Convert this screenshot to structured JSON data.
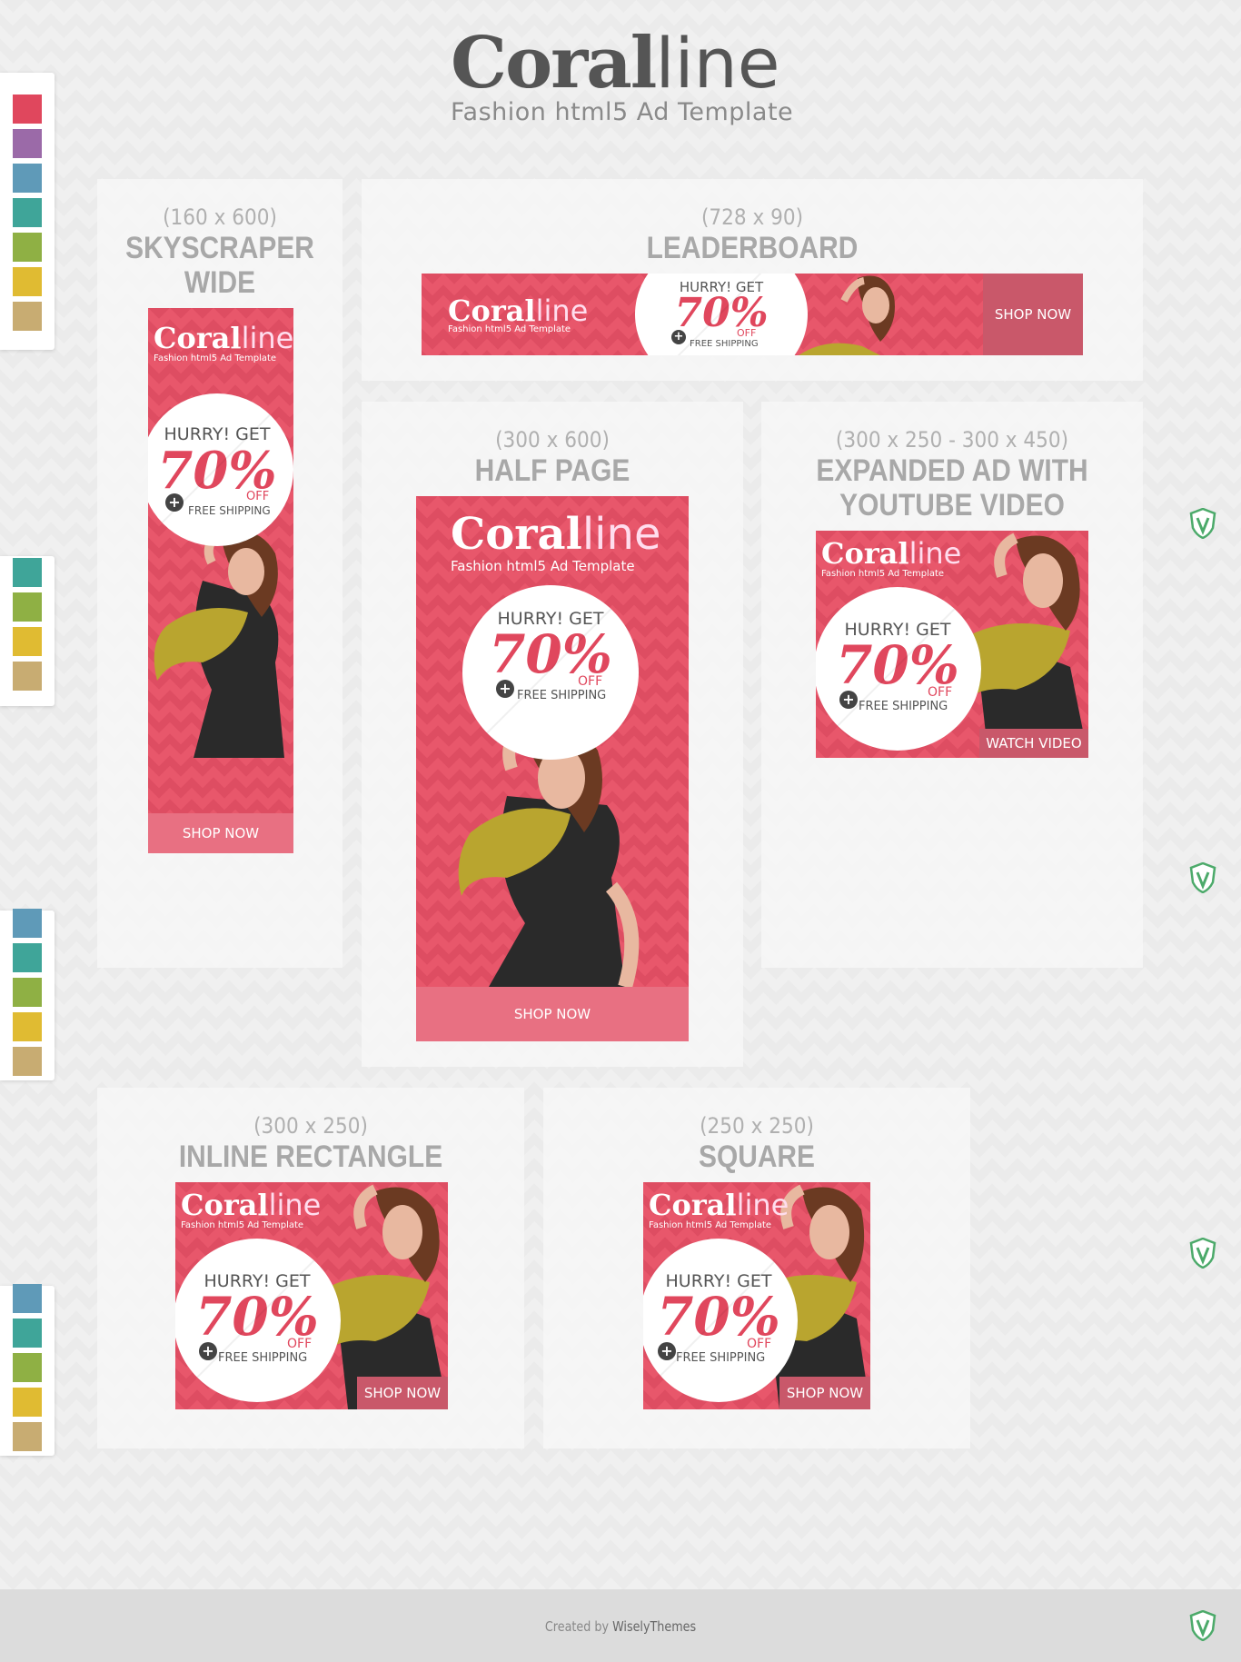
{
  "header": {
    "brand_bold": "Coral",
    "brand_light": "ine",
    "brand_l": "l",
    "tagline": "Fashion html5 Ad Template"
  },
  "ad_copy": {
    "brand_bold": "Coral",
    "brand_light": "line",
    "tagline": "Fashion html5 Ad Template",
    "hurry": "HURRY!",
    "get": "GET",
    "percent": "70%",
    "off": "OFF",
    "free_shipping": "FREE SHIPPING",
    "plus": "+",
    "shop_now": "SHOP NOW",
    "watch_video": "WATCH VIDEO"
  },
  "panels": {
    "skyscraper": {
      "size": "(160 x 600)",
      "name_1": "SKYSCRAPER",
      "name_2": "WIDE"
    },
    "leaderboard": {
      "size": "(728 x 90)",
      "name_1": "LEADERBOARD"
    },
    "half_page": {
      "size": "(300 x 600)",
      "name_1": "HALF PAGE"
    },
    "expanded": {
      "size": "(300 x 250 - 300 x 450)",
      "name_1": "EXPANDED AD WITH",
      "name_2": "YOUTUBE VIDEO"
    },
    "inline": {
      "size": "(300 x 250)",
      "name_1": "INLINE RECTANGLE"
    },
    "square": {
      "size": "(250 x 250)",
      "name_1": "SQUARE"
    }
  },
  "swatch_colors": [
    "#e0475d",
    "#9b6aa8",
    "#5f9ab8",
    "#3fa599",
    "#8fb044",
    "#e0bb32",
    "#c8ac72"
  ],
  "colors": {
    "accent": "#e0475d",
    "cta": "#e87082",
    "cta_dark": "#c9586a"
  },
  "footer": {
    "created_by": "Created by",
    "author": "WiselyThemes"
  }
}
